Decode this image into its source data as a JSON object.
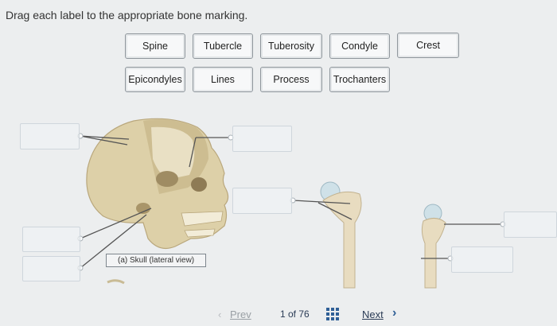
{
  "instruction": "Drag each label to the appropriate bone marking.",
  "labels": [
    "Spine",
    "Tubercle",
    "Tuberosity",
    "Condyle",
    "Crest",
    "Epicondyles",
    "Lines",
    "Process",
    "Trochanters"
  ],
  "figure_caption": "(a) Skull (lateral view)",
  "pagination": {
    "prev": "Prev",
    "page": "1 of 76",
    "next": "Next"
  },
  "icons": {
    "grid": "grid-icon",
    "next": "chevron-right-icon",
    "prev": "chevron-left-icon"
  }
}
